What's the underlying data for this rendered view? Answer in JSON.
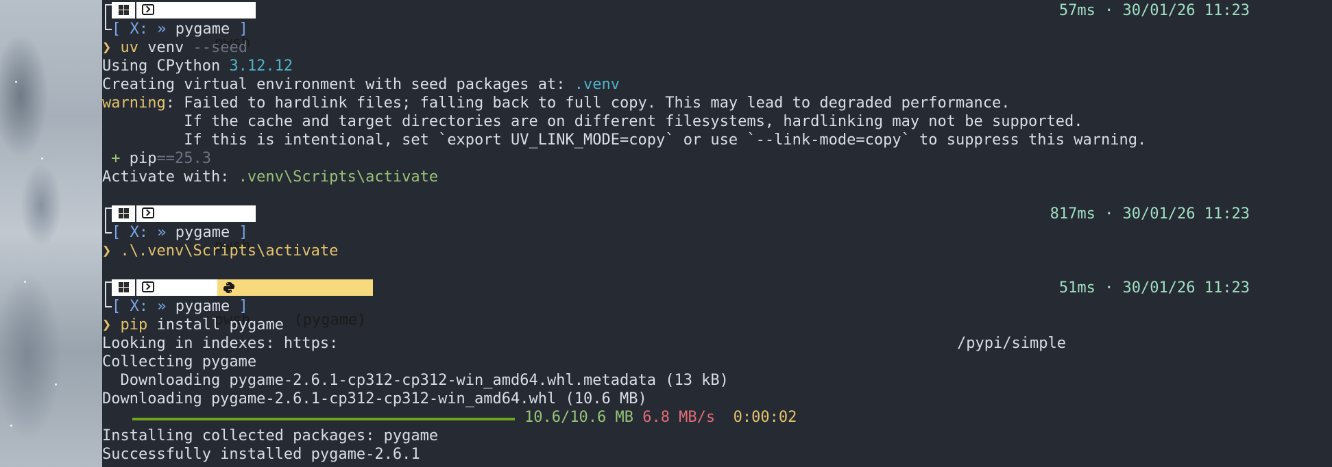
{
  "colors": {
    "terminal_bg": "#262a33",
    "text": "#d8dde6",
    "timing": "#9fe0c2",
    "prompt_arrow": "#e3c36b",
    "path_teal": "#4fb3c7",
    "warning": "#e3c36b",
    "green": "#98c379",
    "dim": "#6b7280",
    "progress_fill": "#6ea51a",
    "speed_red": "#e06c75",
    "venv_segment": "#f7d97e"
  },
  "prompts": [
    {
      "shell": "pwsh",
      "venv": "",
      "path_prefix": "[ X: » ",
      "path_dir": "pygame",
      "path_suffix": " ]",
      "timing": "57ms · 30/01/26 11:23"
    },
    {
      "shell": "pwsh",
      "venv": "",
      "path_prefix": "[ X: » ",
      "path_dir": "pygame",
      "path_suffix": " ]",
      "timing": "817ms · 30/01/26 11:23"
    },
    {
      "shell": "pwsh",
      "venv": "(pygame)",
      "path_prefix": "[ X: » ",
      "path_dir": "pygame",
      "path_suffix": " ]",
      "timing": "51ms · 30/01/26 11:23"
    }
  ],
  "block1": {
    "prompt_arrow": "❯",
    "cmd": "uv",
    "arg": "venv",
    "flag": "--seed",
    "using_prefix": "Using CPython ",
    "using_version": "3.12.12",
    "creating_prefix": "Creating virtual environment with seed packages at: ",
    "creating_path": ".venv",
    "warning_label": "warning",
    "warning_text": ": Failed to hardlink files; falling back to full copy. This may lead to degraded performance.",
    "warning_line2": "         If the cache and target directories are on different filesystems, hardlinking may not be supported.",
    "warning_line3": "         If this is intentional, set `export UV_LINK_MODE=copy` or use `--link-mode=copy` to suppress this warning.",
    "pkg_plus": " + ",
    "pkg_name": "pip",
    "pkg_version": "==25.3",
    "activate_prefix": "Activate with: ",
    "activate_path": ".venv\\Scripts\\activate"
  },
  "block2": {
    "prompt_arrow": "❯",
    "cmd": ".\\.venv\\Scripts\\activate"
  },
  "block3": {
    "prompt_arrow": "❯",
    "cmd": "pip",
    "args": "install pygame",
    "looking": "Looking in indexes: https:",
    "looking_tail": "/pypi/simple",
    "collecting": "Collecting pygame",
    "downloading_meta": "  Downloading pygame-2.6.1-cp312-cp312-win_amd64.whl.metadata (13 kB)",
    "downloading_whl": "Downloading pygame-2.6.1-cp312-cp312-win_amd64.whl (10.6 MB)",
    "progress_fraction": 1.0,
    "progress_size": "10.6/10.6 MB",
    "progress_speed": "6.8 MB/s",
    "progress_eta": "0:00:02",
    "installing": "Installing collected packages: pygame",
    "installed": "Successfully installed pygame-2.6.1"
  }
}
